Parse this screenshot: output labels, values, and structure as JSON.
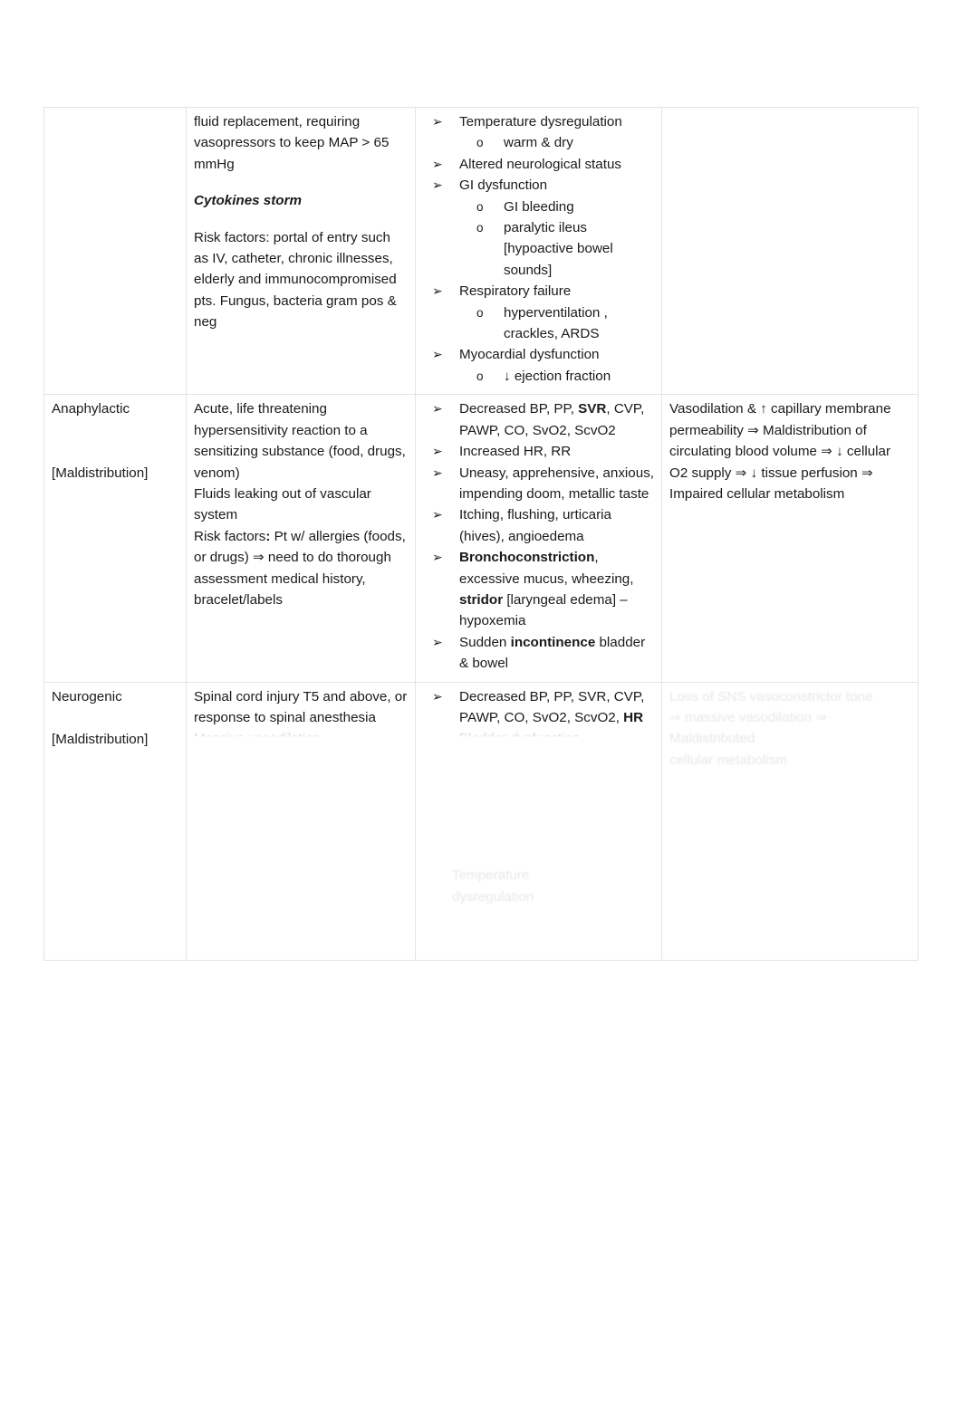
{
  "document": {
    "type": "shock-comparison-table",
    "columns": [
      "",
      "",
      "",
      ""
    ]
  },
  "rows": [
    {
      "name": "sepsis-continued-row",
      "col1": {
        "title": "",
        "subtitle": ""
      },
      "col2": {
        "paragraphs": [
          {
            "text": "fluid replacement, requiring vasopressors to keep MAP > 65 mmHg",
            "style": "normal",
            "spaced": true
          },
          {
            "text": "Cytokines storm",
            "style": "bolditalic",
            "spaced": true
          },
          {
            "text": "Risk factors: portal of entry such as IV, catheter, chronic illnesses, elderly and immunocompromised pts. Fungus, bacteria gram pos & neg",
            "style": "normal",
            "spaced": false
          }
        ]
      },
      "col3": {
        "bullets": [
          {
            "text": "Temperature dysregulation",
            "marker": "➢",
            "sub": [
              {
                "text": "warm & dry",
                "marker": "o"
              }
            ]
          },
          {
            "text": "Altered neurological status",
            "marker": "➢",
            "sub": []
          },
          {
            "text": "GI dysfunction",
            "marker": "➢",
            "sub": [
              {
                "text": "GI bleeding",
                "marker": "o"
              },
              {
                "text": "paralytic ileus [hypoactive bowel sounds]",
                "marker": "o"
              }
            ]
          },
          {
            "text": "Respiratory failure",
            "marker": "➢",
            "sub": [
              {
                "text": "hyperventilation , crackles, ARDS",
                "marker": "o"
              }
            ]
          },
          {
            "text": "Myocardial dysfunction",
            "marker": "➢",
            "sub": [
              {
                "text": "↓ ejection fraction",
                "marker": "o"
              }
            ]
          }
        ]
      },
      "col4": {
        "paragraphs": []
      }
    },
    {
      "name": "anaphylactic-row",
      "col1": {
        "title": "Anaphylactic",
        "subtitle": "[Maldistribution]"
      },
      "col2": {
        "paragraphs": [
          {
            "text": "Acute, life threatening hypersensitivity reaction to a sensitizing substance (food, drugs, venom)",
            "style": "normal",
            "spaced": false
          },
          {
            "text": "Fluids leaking out of vascular system",
            "style": "normal",
            "spaced": false
          },
          {
            "text": "Risk factors: Pt w/ allergies (foods, or drugs) ⇒ need to do thorough assessment medical history, bracelet/labels",
            "style": "normal",
            "spaced": false
          }
        ]
      },
      "col3": {
        "bullets": [
          {
            "text": "Decreased BP, PP, SVR, CVP, PAWP, CO, SvO2, ScvO2",
            "marker": "➢",
            "bold_parts": [
              "SVR"
            ],
            "sub": []
          },
          {
            "text": "Increased HR, RR",
            "marker": "➢",
            "sub": []
          },
          {
            "text": "Uneasy, apprehensive, anxious, impending doom, metallic taste",
            "marker": "➢",
            "sub": []
          },
          {
            "text": "Itching, flushing, urticaria (hives), angioedema",
            "marker": "➢",
            "sub": []
          },
          {
            "text": "Bronchoconstriction, excessive mucus, wheezing, stridor [laryngeal edema] – hypoxemia",
            "marker": "➢",
            "bold_parts": [
              "Bronchoconstriction",
              "stridor"
            ],
            "sub": []
          },
          {
            "text": "Sudden incontinence bladder & bowel",
            "marker": "➢",
            "bold_parts": [
              "incontinence"
            ],
            "sub": []
          }
        ]
      },
      "col4": {
        "paragraphs": [
          {
            "text": "Vasodilation & ↑ capillary membrane permeability ⇒ Maldistribution of circulating blood volume ⇒ ↓ cellular O2 supply ⇒ ↓ tissue perfusion ⇒ Impaired cellular metabolism",
            "style": "normal",
            "spaced": false
          }
        ]
      }
    },
    {
      "name": "neurogenic-row",
      "col1": {
        "title": "Neurogenic",
        "subtitle": "[Maldistribution]"
      },
      "col2": {
        "paragraphs": [
          {
            "text": "Spinal cord injury T5 and above, or response to spinal anesthesia",
            "style": "normal",
            "spaced": false
          }
        ],
        "cut_off_line": "Massive vasodilation"
      },
      "col3": {
        "bullets": [
          {
            "text": "Decreased BP, PP, SVR, CVP, PAWP, CO, SvO2, ScvO2, HR",
            "marker": "➢",
            "bold_parts": [
              "HR"
            ],
            "sub": []
          }
        ],
        "cut_off_line": "Bladder dysfunction",
        "faint_lines": [
          "Temperature",
          "dysregulation"
        ]
      },
      "col4": {
        "faint_lines": [
          "Loss of SNS vasoconstrictor tone",
          "⇒ massive vasodilation ⇒ Maldistributed",
          "cellular metabolism"
        ]
      }
    }
  ]
}
